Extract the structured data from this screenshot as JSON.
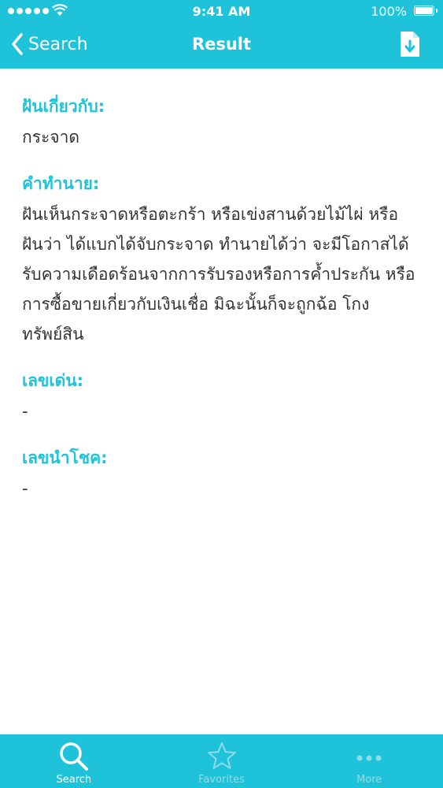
{
  "status_bar": {
    "time": "9:41 AM",
    "battery": "100%"
  },
  "nav": {
    "back_label": "Search",
    "title": "Result",
    "save_icon": "save-file-icon"
  },
  "sections": [
    {
      "label": "ฝันเกี่ยวกับ:",
      "value": "กระจาด"
    },
    {
      "label": "คำทำนาย:",
      "value": "ฝันเห็นกระจาดหรือตะกร้า หรือเข่งสานด้วยไม้ไผ่ หรือ ฝันว่า ได้แบกได้จับกระจาด ทำนายได้ว่า จะมีโอกาสได้รับความเดือดร้อนจากการรับรองหรือการค้ำประกัน หรือการซื้อขายเกี่ยวกับเงินเชื่อ มิฉะนั้นก็จะถูกฉ้อ โกงทรัพย์สิน"
    },
    {
      "label": "เลขเด่น:",
      "value": "-"
    },
    {
      "label": "เลขนำโชค:",
      "value": "-"
    }
  ],
  "tabs": [
    {
      "label": "Search",
      "icon": "search-icon",
      "active": true
    },
    {
      "label": "Favorites",
      "icon": "star-icon",
      "active": false
    },
    {
      "label": "More",
      "icon": "more-icon",
      "active": false
    }
  ],
  "colors": {
    "accent": "#1ec3d9",
    "text": "#333333",
    "inactive_tab": "#8fdbe6"
  }
}
